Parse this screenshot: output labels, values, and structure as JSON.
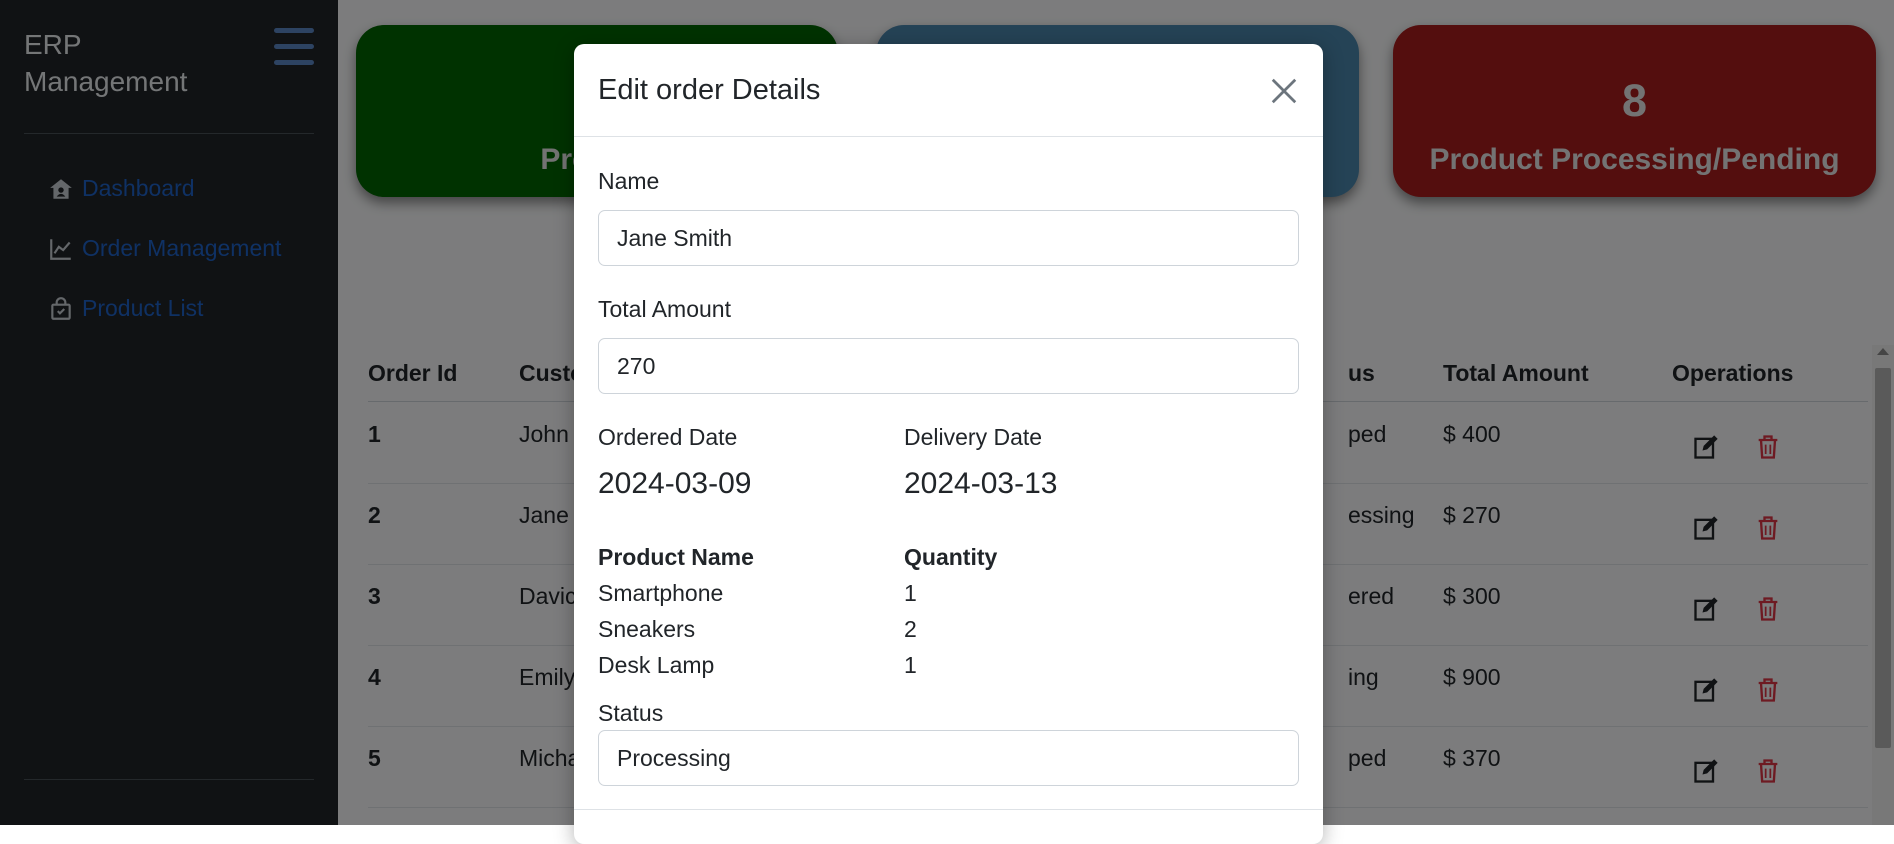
{
  "sidebar": {
    "brand": "ERP Management",
    "items": [
      {
        "label": "Dashboard",
        "icon": "home-icon"
      },
      {
        "label": "Order Management",
        "icon": "chart-line-icon"
      },
      {
        "label": "Product List",
        "icon": "shopping-bag-icon"
      }
    ]
  },
  "cards": [
    {
      "value": "",
      "label": "Product",
      "color": "#006400"
    },
    {
      "value": "",
      "label": "",
      "color": "#4a86ad"
    },
    {
      "value": "8",
      "label": "Product Processing/Pending",
      "color": "#a81c1c"
    }
  ],
  "table": {
    "headers": [
      "Order Id",
      "Custo",
      "us",
      "Total Amount",
      "Operations"
    ],
    "rows": [
      {
        "id": "1",
        "customer": "John",
        "status": "ped",
        "amount": "$ 400"
      },
      {
        "id": "2",
        "customer": "Jane",
        "status": "essing",
        "amount": "$ 270"
      },
      {
        "id": "3",
        "customer": "Davic",
        "status": "ered",
        "amount": "$ 300"
      },
      {
        "id": "4",
        "customer": "Emily",
        "status": "ing",
        "amount": "$ 900"
      },
      {
        "id": "5",
        "customer": "Micha",
        "status": "ped",
        "amount": "$ 370"
      }
    ]
  },
  "modal": {
    "title": "Edit order Details",
    "name_label": "Name",
    "name_value": "Jane Smith",
    "total_label": "Total Amount",
    "total_value": "270",
    "ordered_label": "Ordered Date",
    "ordered_value": "2024-03-09",
    "delivery_label": "Delivery Date",
    "delivery_value": "2024-03-13",
    "product_header": "Product Name",
    "quantity_header": "Quantity",
    "products": [
      {
        "name": "Smartphone",
        "qty": "1"
      },
      {
        "name": "Sneakers",
        "qty": "2"
      },
      {
        "name": "Desk Lamp",
        "qty": "1"
      }
    ],
    "status_label": "Status",
    "status_value": "Processing"
  },
  "colors": {
    "sidebar_bg": "#212529",
    "link": "#1e62c9",
    "edit_icon": "#212529",
    "delete_icon": "#dc3545"
  }
}
